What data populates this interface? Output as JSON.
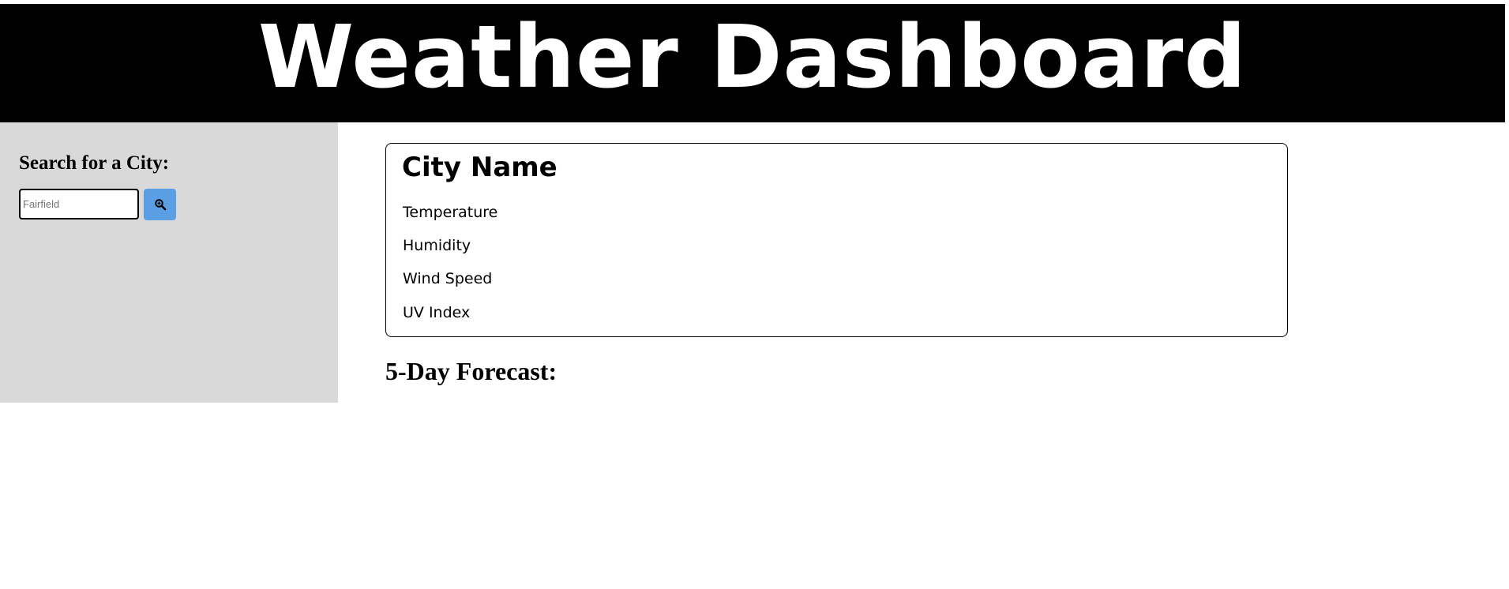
{
  "header": {
    "title": "Weather Dashboard"
  },
  "sidebar": {
    "heading": "Search for a City:",
    "search": {
      "placeholder": "Fairfield",
      "value": ""
    },
    "search_button_icon": "search-icon"
  },
  "current": {
    "city_name": "City Name",
    "temperature_label": "Temperature",
    "humidity_label": "Humidity",
    "wind_label": "Wind Speed",
    "uv_label": "UV Index"
  },
  "forecast": {
    "heading": "5-Day Forecast:"
  },
  "colors": {
    "header_bg": "#000000",
    "header_text": "#ffffff",
    "sidebar_bg": "#d9d9d9",
    "button_bg": "#5a9ee4"
  }
}
